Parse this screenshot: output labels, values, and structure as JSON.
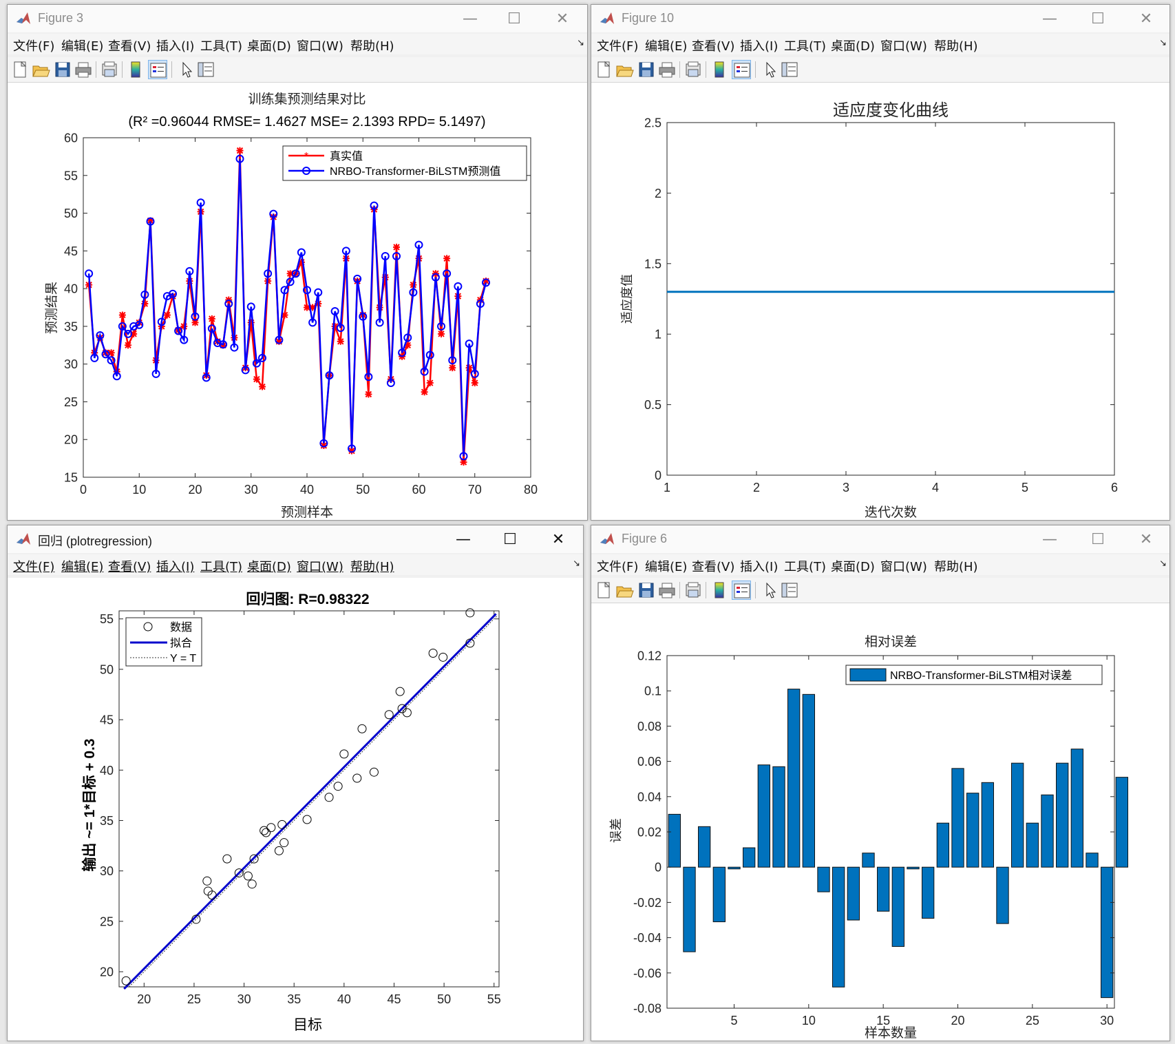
{
  "windows": {
    "w3": {
      "title": "Figure 3"
    },
    "w10": {
      "title": "Figure 10"
    },
    "wreg": {
      "title": "回归 (plotregression)"
    },
    "w6": {
      "title": "Figure 6"
    }
  },
  "menus": {
    "standard": [
      "文件(F)",
      "编辑(E)",
      "查看(V)",
      "插入(I)",
      "工具(T)",
      "桌面(D)",
      "窗口(W)",
      "帮助(H)"
    ]
  },
  "icons": [
    "new-figure-icon",
    "open-file-icon",
    "save-icon",
    "print-icon",
    "print-preview-icon",
    "colorbar-icon",
    "legend-icon",
    "pointer-icon",
    "property-inspector-icon"
  ],
  "chart_data": [
    {
      "type": "line",
      "title": "训练集预测结果对比",
      "subtitle": "(R² =0.96044 RMSE= 1.4627 MSE= 2.1393 RPD= 5.1497)",
      "xlabel": "预测样本",
      "ylabel": "预测结果",
      "xlim": [
        0,
        80
      ],
      "ylim": [
        15,
        60
      ],
      "xticks": [
        0,
        10,
        20,
        30,
        40,
        50,
        60,
        70,
        80
      ],
      "yticks": [
        15,
        20,
        25,
        30,
        35,
        40,
        45,
        50,
        55,
        60
      ],
      "legend": "top-right",
      "x": [
        1,
        2,
        3,
        4,
        5,
        6,
        7,
        8,
        9,
        10,
        11,
        12,
        13,
        14,
        15,
        16,
        17,
        18,
        19,
        20,
        21,
        22,
        23,
        24,
        25,
        26,
        27,
        28,
        29,
        30,
        31,
        32,
        33,
        34,
        35,
        36,
        37,
        38,
        39,
        40,
        41,
        42,
        43,
        44,
        45,
        46,
        47,
        48,
        49,
        50,
        51,
        52,
        53,
        54,
        55,
        56,
        57,
        58,
        59,
        60,
        61,
        62,
        63,
        64,
        65,
        66,
        67,
        68,
        69,
        70,
        71,
        72
      ],
      "series": [
        {
          "name": "真实值",
          "color": "#ff0000",
          "marker": "asterisk",
          "values": [
            40.5,
            31.5,
            33.5,
            31.5,
            31.5,
            29,
            36.5,
            32.5,
            34,
            35.5,
            38,
            49,
            30.5,
            35,
            36.5,
            39,
            34.5,
            35,
            41,
            35.5,
            50.2,
            28.5,
            36,
            33,
            32.5,
            38.5,
            33.5,
            58.3,
            29.5,
            35.5,
            28,
            27,
            41,
            49.5,
            33,
            36.5,
            42,
            42,
            43.5,
            37.5,
            37.5,
            38,
            19.2,
            28.5,
            35,
            33,
            44,
            18.5,
            41,
            36.5,
            26,
            50.5,
            37.5,
            41.5,
            28,
            45.5,
            31,
            32.5,
            40.5,
            44,
            26.3,
            27.5,
            42,
            34,
            44,
            29.5,
            39,
            17,
            29.5,
            27.5,
            38.5,
            41
          ]
        },
        {
          "name": "NRBO-Transformer-BiLSTM预测值",
          "color": "#0000ff",
          "marker": "circle",
          "values": [
            42,
            30.8,
            33.8,
            31.3,
            30.5,
            28.4,
            35,
            34,
            35,
            35.2,
            39.2,
            48.9,
            28.7,
            35.6,
            39,
            39.3,
            34.4,
            33.2,
            42.3,
            36.3,
            51.4,
            28.2,
            34.7,
            32.8,
            32.6,
            38,
            32.2,
            57.2,
            29.2,
            37.6,
            30.1,
            30.8,
            42,
            49.9,
            33.2,
            39.8,
            40.9,
            42,
            44.8,
            39.8,
            35.5,
            39.5,
            19.5,
            28.5,
            37,
            34.8,
            45,
            18.8,
            41.3,
            36.3,
            28.3,
            51,
            35.5,
            44.3,
            27.5,
            44.3,
            31.5,
            33.5,
            39.5,
            45.8,
            29,
            31.2,
            41.5,
            35,
            42,
            30.5,
            40.3,
            17.8,
            32.7,
            28.7,
            38,
            40.8
          ]
        }
      ]
    },
    {
      "type": "line",
      "title": "适应度变化曲线",
      "xlabel": "迭代次数",
      "ylabel": "适应度值",
      "xlim": [
        1,
        6
      ],
      "ylim": [
        0,
        2.5
      ],
      "xticks": [
        "1",
        "2",
        "3",
        "4",
        "5",
        "6"
      ],
      "yticks": [
        "0",
        "0.5",
        "1",
        "1.5",
        "2",
        "2.5"
      ],
      "x": [
        1,
        2,
        3,
        4,
        5,
        6
      ],
      "series": [
        {
          "color": "#0072bd",
          "values": [
            1.3,
            1.3,
            1.3,
            1.3,
            1.3,
            1.3
          ]
        }
      ]
    },
    {
      "type": "scatter",
      "title": "回归图: R=0.98322",
      "xlabel": "目标",
      "ylabel": "输出 ~= 1*目标 + 0.3",
      "xlim": [
        17.5,
        55.5
      ],
      "ylim": [
        18.5,
        55.8
      ],
      "xticks": [
        20,
        25,
        30,
        35,
        40,
        45,
        50,
        55
      ],
      "yticks": [
        20,
        25,
        30,
        35,
        40,
        45,
        50,
        55
      ],
      "legend": "top-left",
      "legend_entries": [
        "数据",
        "拟合",
        "Y = T"
      ],
      "points": [
        [
          18.2,
          19.1
        ],
        [
          25.2,
          25.2
        ],
        [
          26.3,
          29
        ],
        [
          26.4,
          28
        ],
        [
          26.8,
          27.6
        ],
        [
          28.3,
          31.2
        ],
        [
          29.5,
          29.8
        ],
        [
          30.4,
          29.5
        ],
        [
          30.8,
          28.7
        ],
        [
          31,
          31.2
        ],
        [
          32,
          34
        ],
        [
          32.2,
          33.8
        ],
        [
          32.7,
          34.3
        ],
        [
          33.5,
          32
        ],
        [
          33.8,
          34.6
        ],
        [
          34,
          32.8
        ],
        [
          36.3,
          35.1
        ],
        [
          38.5,
          37.3
        ],
        [
          39.4,
          38.4
        ],
        [
          40,
          41.6
        ],
        [
          41.3,
          39.2
        ],
        [
          41.8,
          44.1
        ],
        [
          43,
          39.8
        ],
        [
          44.5,
          45.5
        ],
        [
          45.6,
          47.8
        ],
        [
          45.8,
          46.1
        ],
        [
          46.3,
          45.7
        ],
        [
          48.9,
          51.6
        ],
        [
          49.9,
          51.2
        ],
        [
          52.6,
          52.6
        ],
        [
          52.6,
          55.6
        ]
      ],
      "fit": {
        "slope": 1,
        "intercept": 0.3
      }
    },
    {
      "type": "bar",
      "title": "相对误差",
      "xlabel": "样本数量",
      "ylabel": "误差",
      "xlim": [
        0.5,
        30.5
      ],
      "ylim": [
        -0.08,
        0.12
      ],
      "xticks": [
        5,
        10,
        15,
        20,
        25,
        30
      ],
      "yticks": [
        "-0.08",
        "-0.06",
        "-0.04",
        "-0.02",
        "0",
        "0.02",
        "0.04",
        "0.06",
        "0.08",
        "0.1",
        "0.12"
      ],
      "legend": "top-right",
      "series": [
        {
          "name": "NRBO-Transformer-BiLSTM相对误差",
          "color": "#0072bd",
          "values": [
            0.03,
            -0.048,
            0.023,
            -0.031,
            -0.001,
            0.011,
            0.058,
            0.057,
            0.101,
            0.098,
            -0.014,
            -0.068,
            -0.03,
            0.008,
            -0.025,
            -0.045,
            -0.001,
            -0.029,
            0.025,
            0.056,
            0.042,
            0.048,
            -0.032,
            0.059,
            0.025,
            0.041,
            0.059,
            0.067,
            0.008,
            -0.074,
            0.051
          ]
        }
      ]
    }
  ]
}
